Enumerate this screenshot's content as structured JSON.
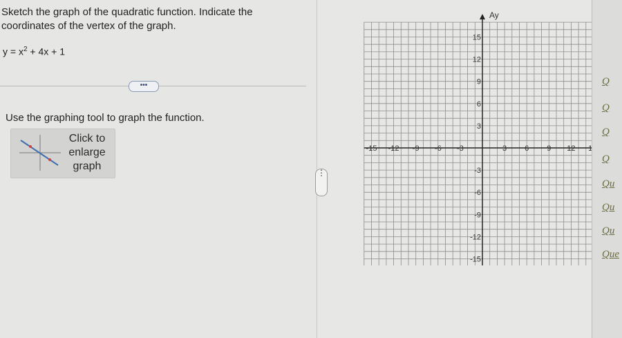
{
  "question": {
    "line1": "Sketch the graph of the quadratic function. Indicate the",
    "line2": "coordinates of the vertex of the graph.",
    "equation_prefix": "y = x",
    "equation_exp": "2",
    "equation_suffix": " + 4x + 1"
  },
  "more_button": "•••",
  "instruction": "Use the graphing tool to graph the function.",
  "enlarge": {
    "line1": "Click to",
    "line2": "enlarge",
    "line3": "graph"
  },
  "splitter_label": "⋮",
  "graph": {
    "axis_label_y": "Ay",
    "x_ticks": [
      "-15",
      "-12",
      "-9",
      "-6",
      "-3",
      "3",
      "6",
      "9",
      "12",
      "1"
    ],
    "y_ticks": [
      "15",
      "12",
      "9",
      "6",
      "3",
      "-3",
      "-6",
      "-9",
      "-12",
      "-15"
    ]
  },
  "side_links": [
    "Q",
    "Q",
    "Q",
    "Q",
    "Qu",
    "Qu",
    "Qu",
    "Que"
  ]
}
